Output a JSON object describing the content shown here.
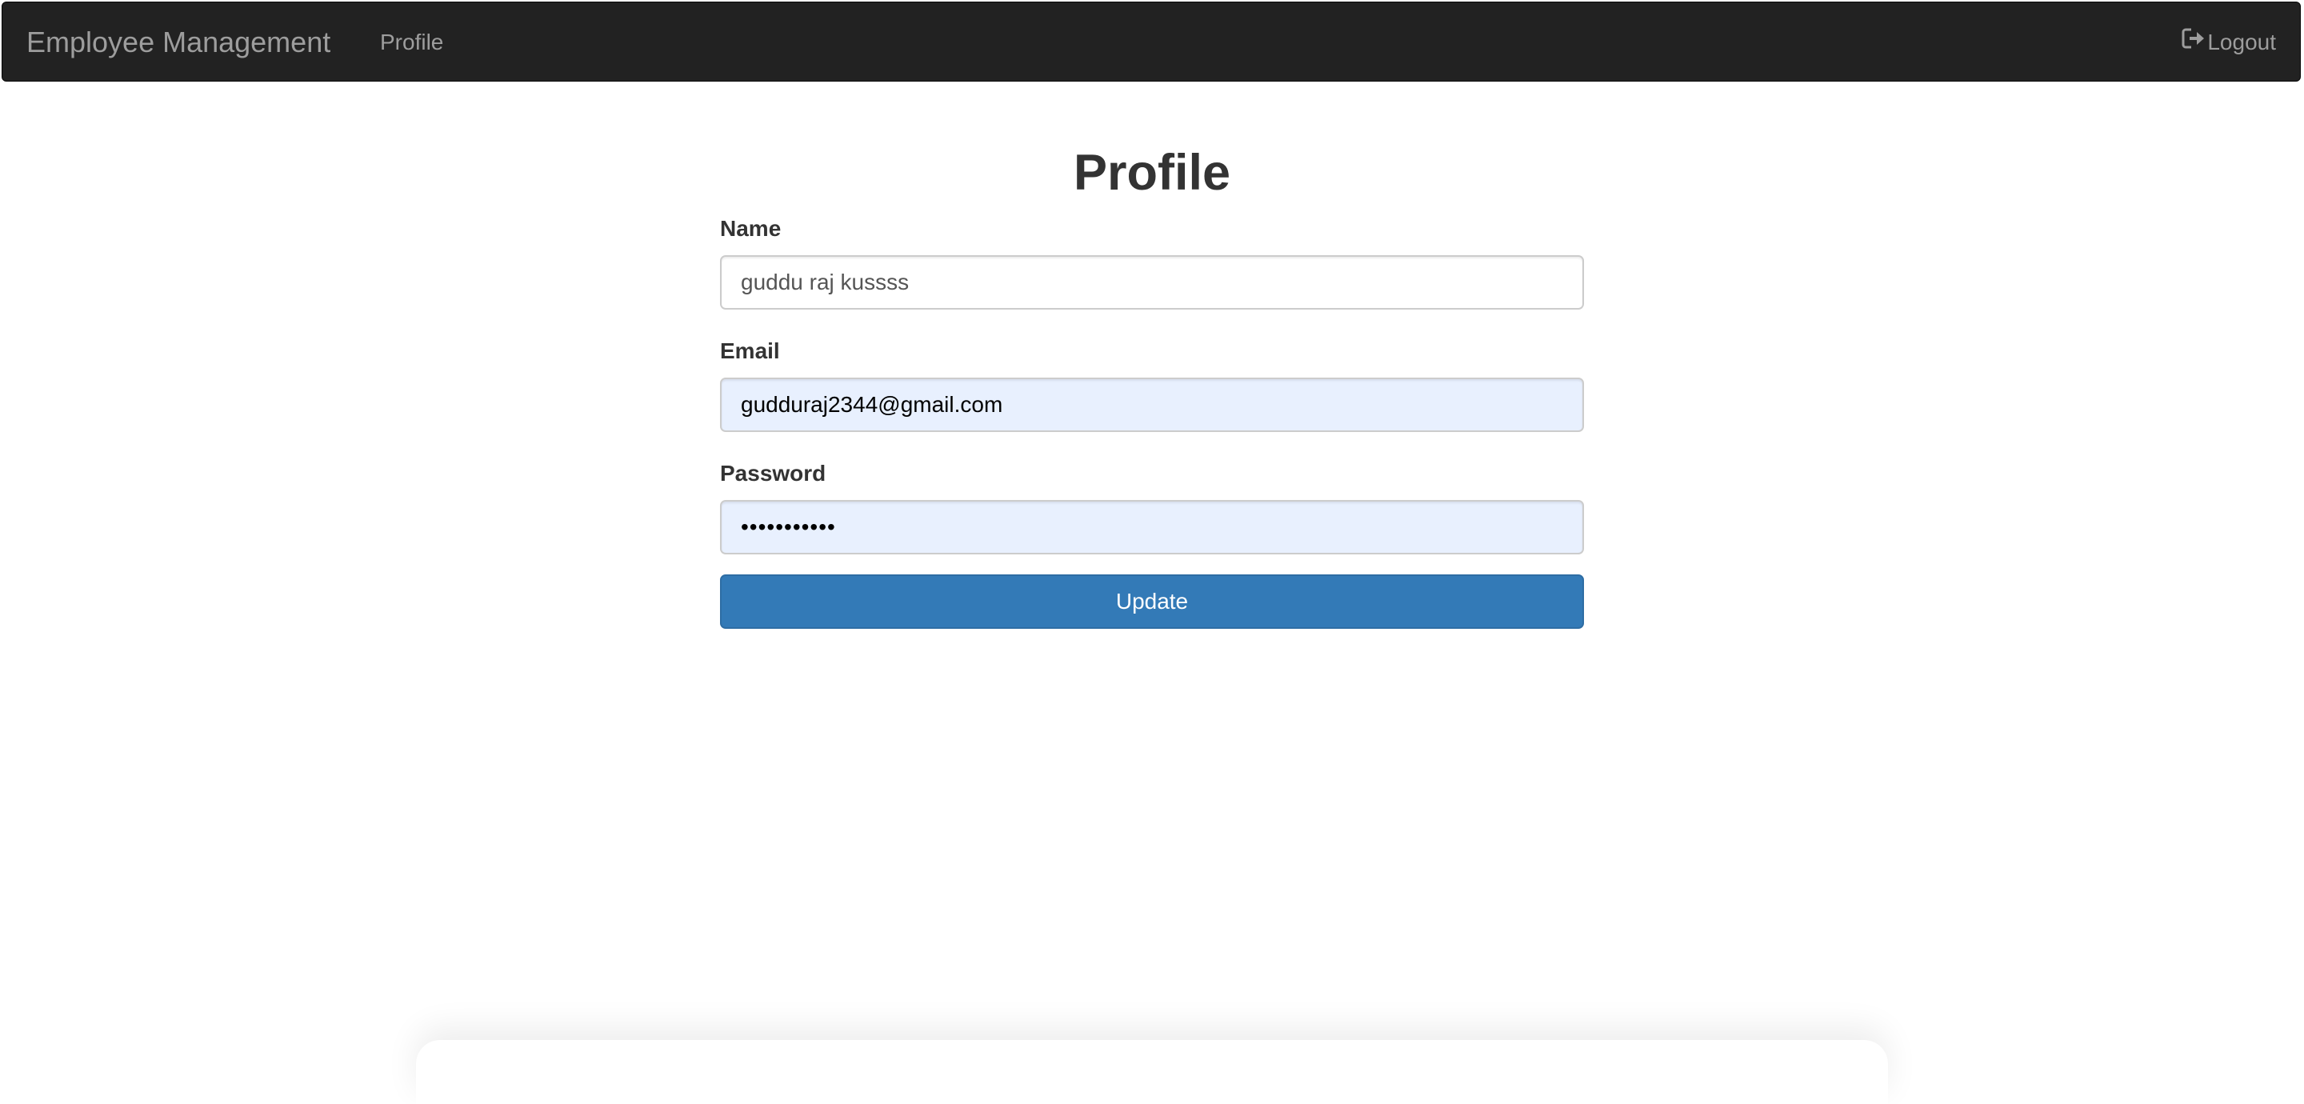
{
  "navbar": {
    "brand": "Employee Management",
    "profile_link": "Profile",
    "logout_label": "Logout",
    "logout_icon": "logout-icon"
  },
  "page": {
    "title": "Profile"
  },
  "form": {
    "name_label": "Name",
    "name_value": "guddu raj kussss",
    "email_label": "Email",
    "email_value": "gudduraj2344@gmail.com",
    "password_label": "Password",
    "password_value": "•••••••••••",
    "submit_label": "Update"
  },
  "colors": {
    "navbar_bg": "#222222",
    "primary_button": "#337ab7",
    "autofill_bg": "#e8f0fe"
  }
}
